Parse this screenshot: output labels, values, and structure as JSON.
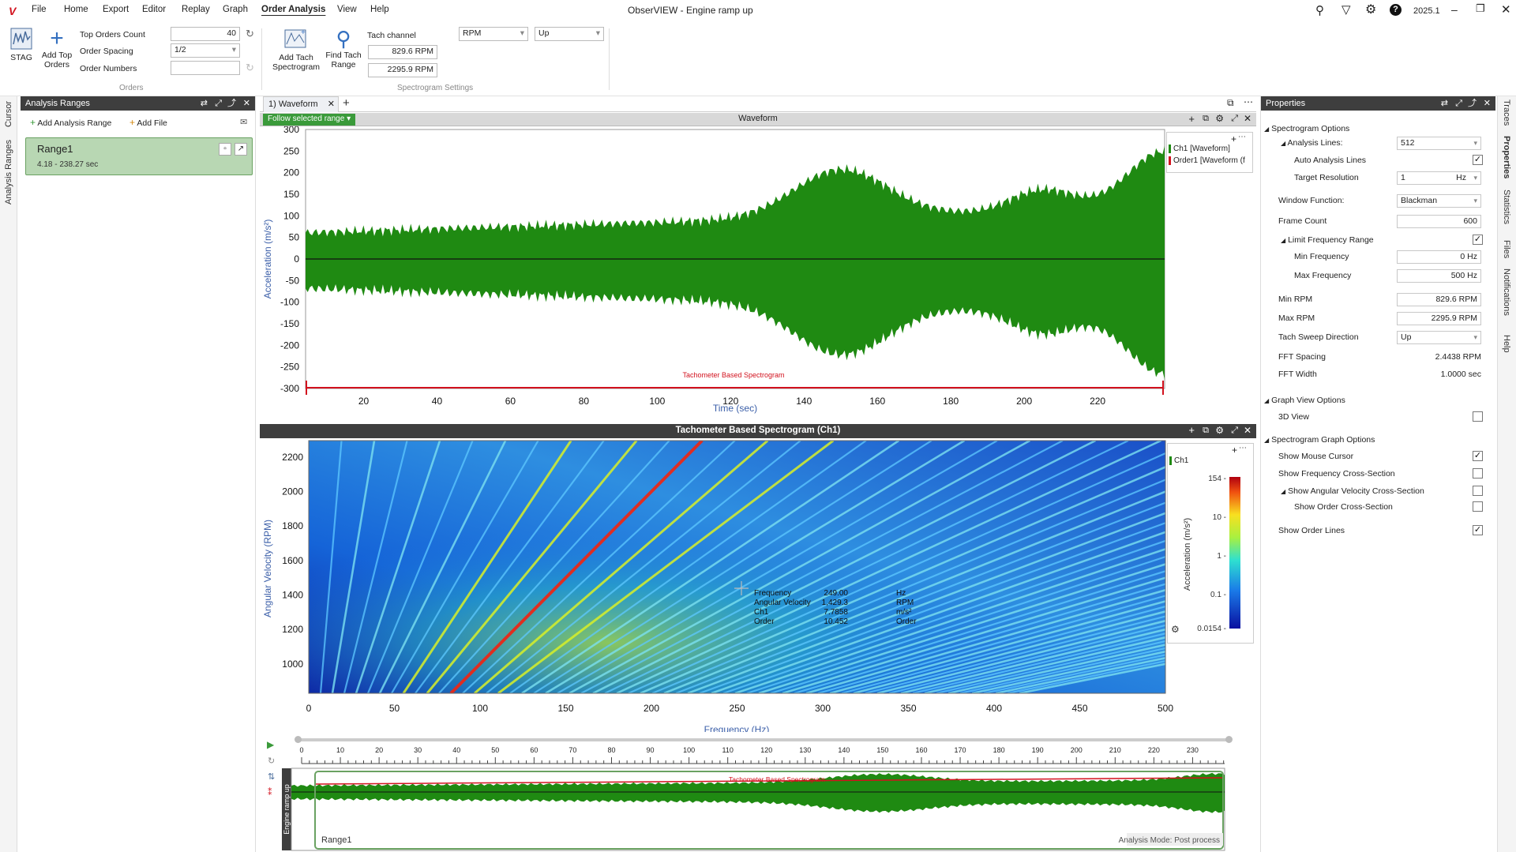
{
  "app": {
    "title": "ObserVIEW - Engine ramp up",
    "version": "2025.1",
    "menu": [
      "File",
      "Home",
      "Export",
      "Editor",
      "Replay",
      "Graph",
      "Order Analysis",
      "View",
      "Help"
    ],
    "active_menu": "Order Analysis"
  },
  "ribbon": {
    "stag": "STAG",
    "add_top_orders_1": "Add Top",
    "add_top_orders_2": "Orders",
    "top_orders_count_label": "Top Orders Count",
    "top_orders_count": "40",
    "order_spacing_label": "Order Spacing",
    "order_spacing": "1/2",
    "order_numbers_label": "Order Numbers",
    "order_numbers": "",
    "orders_group": "Orders",
    "add_tach_1": "Add Tach",
    "add_tach_2": "Spectrogram",
    "find_tach_1": "Find Tach",
    "find_tach_2": "Range",
    "tach_channel_label": "Tach channel",
    "min_rpm": "829.6 RPM",
    "max_rpm": "2295.9 RPM",
    "unit_select": "RPM",
    "direction_select": "Up",
    "spectrogram_group": "Spectrogram Settings"
  },
  "left_tabs": [
    "Cursor",
    "Analysis Ranges"
  ],
  "analysis_ranges": {
    "header": "Analysis Ranges",
    "add_range": "Add Analysis Range",
    "add_file": "Add File",
    "range_name": "Range1",
    "range_span": "4.18 - 238.27 sec"
  },
  "doc_tab": "1) Waveform",
  "waveform": {
    "header": "Waveform",
    "follow_range": "Follow selected range",
    "y_label": "Acceleration (m/s²)",
    "x_label": "Time (sec)",
    "y_ticks": [
      "300",
      "250",
      "200",
      "150",
      "100",
      "50",
      "0",
      "-50",
      "-100",
      "-150",
      "-200",
      "-250",
      "-300"
    ],
    "x_ticks": [
      "20",
      "40",
      "60",
      "80",
      "100",
      "120",
      "140",
      "160",
      "180",
      "200",
      "220"
    ],
    "legend": [
      "Ch1 [Waveform]",
      "Order1 [Waveform (f"
    ],
    "range_marker": "Tachometer Based Spectrogram"
  },
  "spectrogram": {
    "header": "Tachometer Based Spectrogram (Ch1)",
    "y_label": "Angular Velocity (RPM)",
    "x_label": "Frequency (Hz)",
    "y_ticks": [
      "2200",
      "2000",
      "1800",
      "1600",
      "1400",
      "1200",
      "1000"
    ],
    "x_ticks": [
      "0",
      "50",
      "100",
      "150",
      "200",
      "250",
      "300",
      "350",
      "400",
      "450",
      "500"
    ],
    "legend": "Ch1",
    "colorbar_label": "Acceleration (m/s²)",
    "colorbar_ticks": [
      "154 -",
      "10 -",
      "1 -",
      "0.1 -",
      "0.0154 -"
    ],
    "cursor": {
      "rows": [
        {
          "name": "Frequency",
          "value": "249.00",
          "unit": "Hz"
        },
        {
          "name": "Angular Velocity",
          "value": "1,429.3",
          "unit": "RPM"
        },
        {
          "name": "Ch1",
          "value": "7.7858",
          "unit": "m/s²"
        },
        {
          "name": "Order",
          "value": "10.452",
          "unit": "Order"
        }
      ]
    }
  },
  "overview": {
    "ticks": [
      "0",
      "10",
      "20",
      "30",
      "40",
      "50",
      "60",
      "70",
      "80",
      "90",
      "100",
      "110",
      "120",
      "130",
      "140",
      "150",
      "160",
      "170",
      "180",
      "190",
      "200",
      "210",
      "220",
      "230"
    ],
    "side_label": "Engine ramp up",
    "range_label": "Range1",
    "range_marker": "Tachometer Based Spectrogram",
    "mode": "Analysis Mode: Post process"
  },
  "properties": {
    "header": "Properties",
    "spectrogram_options": "Spectrogram Options",
    "analysis_lines_label": "Analysis Lines:",
    "analysis_lines": "512",
    "auto_analysis_lines": "Auto Analysis Lines",
    "target_resolution": "Target Resolution",
    "target_resolution_value": "1",
    "target_resolution_unit": "Hz",
    "window_function": "Window Function:",
    "window_function_value": "Blackman",
    "frame_count": "Frame Count",
    "frame_count_value": "600",
    "limit_freq": "Limit Frequency Range",
    "min_freq": "Min Frequency",
    "min_freq_value": "0 Hz",
    "max_freq": "Max Frequency",
    "max_freq_value": "500 Hz",
    "min_rpm": "Min RPM",
    "min_rpm_value": "829.6 RPM",
    "max_rpm": "Max RPM",
    "max_rpm_value": "2295.9 RPM",
    "tach_dir": "Tach Sweep Direction",
    "tach_dir_value": "Up",
    "fft_spacing": "FFT Spacing",
    "fft_spacing_value": "2.4438 RPM",
    "fft_width": "FFT Width",
    "fft_width_value": "1.0000 sec",
    "graph_view_options": "Graph View Options",
    "view_3d": "3D View",
    "spectrogram_graph_options": "Spectrogram Graph Options",
    "show_mouse_cursor": "Show Mouse Cursor",
    "show_freq_cs": "Show Frequency Cross-Section",
    "show_angular_cs": "Show Angular Velocity Cross-Section",
    "show_order_cs": "Show Order Cross-Section",
    "show_order_lines": "Show Order Lines"
  },
  "right_tabs": [
    "Traces",
    "Properties",
    "Statistics",
    "Files",
    "Notifications",
    "Help"
  ],
  "colors": {
    "waveform": "#1f8a12",
    "accent": "#d2121e",
    "panel_header": "#3e3e3e",
    "range_fill": "#b8d7b3"
  }
}
